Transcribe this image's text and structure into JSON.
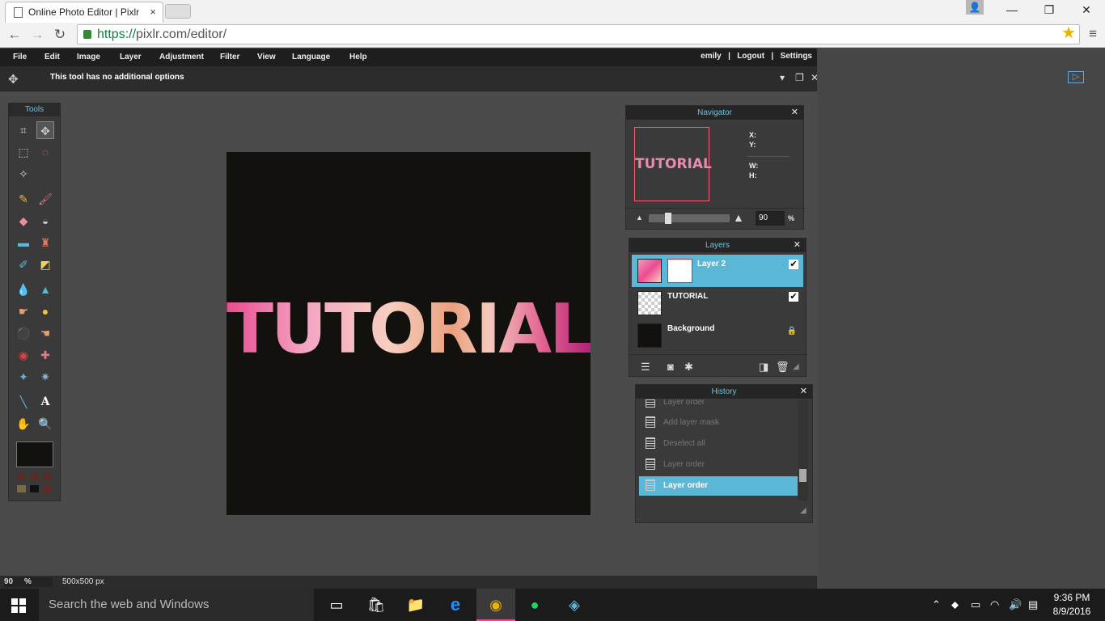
{
  "browser": {
    "tab_title": "Online Photo Editor | Pixlr",
    "tab_close": "×",
    "url_scheme": "https://",
    "url_rest": "pixlr.com/editor/"
  },
  "menu": {
    "items": [
      "File",
      "Edit",
      "Image",
      "Layer",
      "Adjustment",
      "Filter",
      "View",
      "Language",
      "Help"
    ],
    "user": "emily",
    "logout": "Logout",
    "settings": "Settings"
  },
  "options": {
    "message": "This tool has no additional options"
  },
  "tools": {
    "title": "Tools",
    "foreground_color": "#12110d"
  },
  "canvas": {
    "text": "TUTORIAL",
    "background": "#12110d"
  },
  "navigator": {
    "title": "Navigator",
    "thumb_text": "TUTORIAL",
    "x_label": "X:",
    "y_label": "Y:",
    "w_label": "W:",
    "h_label": "H:",
    "zoom": "90",
    "zoom_unit": "%"
  },
  "layers": {
    "title": "Layers",
    "items": [
      {
        "name": "Layer 2",
        "selected": true,
        "visible": true
      },
      {
        "name": "TUTORIAL",
        "selected": false,
        "visible": true
      },
      {
        "name": "Background",
        "selected": false,
        "locked": true
      }
    ]
  },
  "history": {
    "title": "History",
    "items": [
      "Layer order",
      "Add layer mask",
      "Deselect all",
      "Layer order",
      "Layer order"
    ]
  },
  "status": {
    "zoom": "90",
    "zoom_unit": "%",
    "size": "500x500 px"
  },
  "taskbar": {
    "search_placeholder": "Search the web and Windows",
    "time": "9:36 PM",
    "date": "8/9/2016"
  },
  "colors": {
    "accent": "#5ab8d6",
    "panel_title": "#6bc3e0"
  }
}
